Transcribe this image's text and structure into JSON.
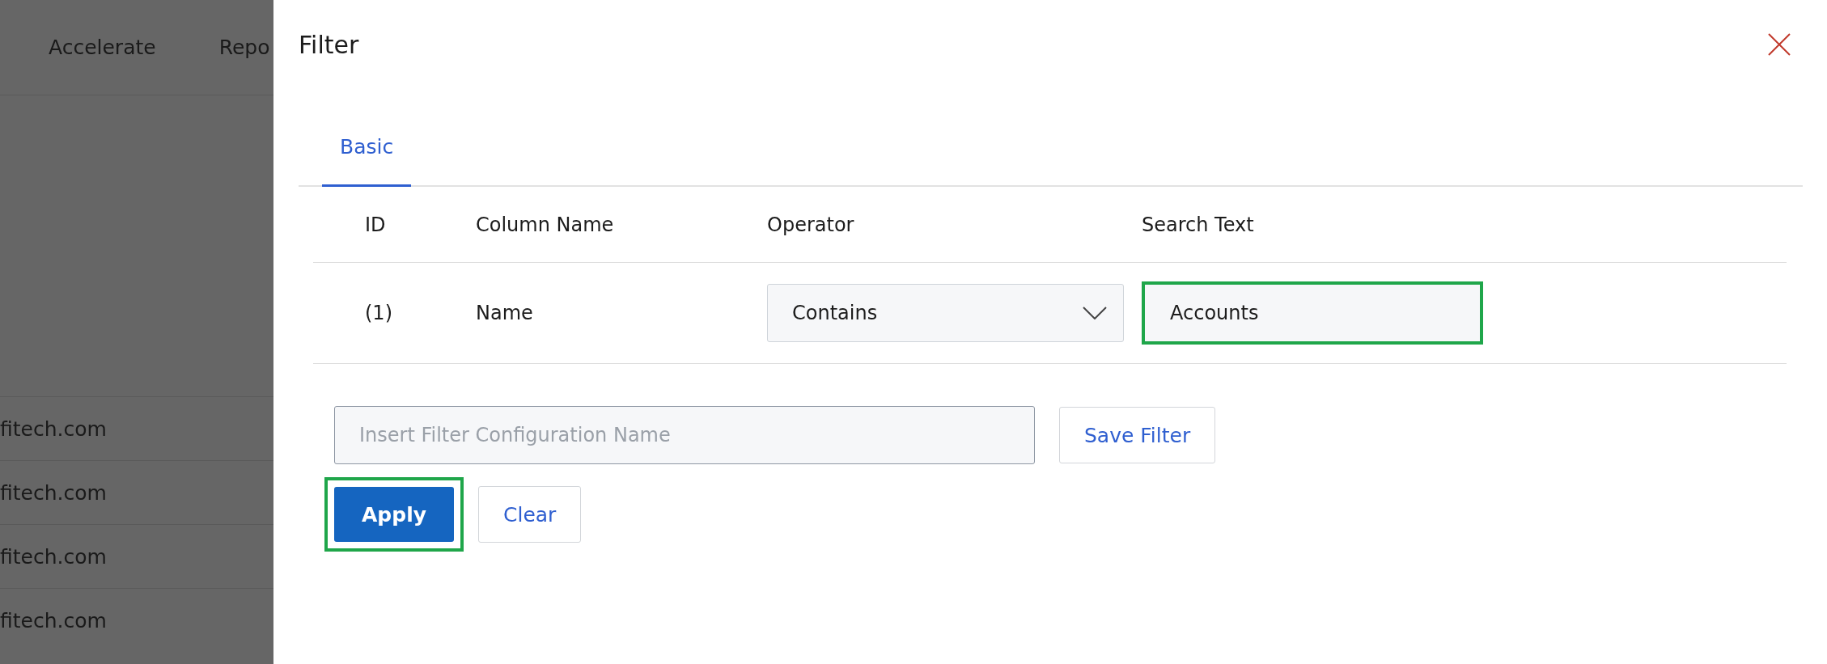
{
  "background_page": {
    "nav_items": [
      "Accelerate",
      "Repo"
    ],
    "rows": [
      "fitech.com",
      "fitech.com",
      "fitech.com",
      "fitech.com"
    ]
  },
  "filter_panel": {
    "title": "Filter",
    "tabs": [
      {
        "label": "Basic",
        "selected": true
      }
    ],
    "table": {
      "columns": [
        "ID",
        "Column Name",
        "Operator",
        "Search Text"
      ],
      "rows": [
        {
          "id": "(1)",
          "column_name": "Name",
          "operator": "Contains",
          "search_text": "Accounts",
          "search_highlighted": true
        }
      ]
    },
    "config_name": {
      "placeholder": "Insert Filter Configuration Name"
    },
    "save_button": "Save Filter",
    "apply_button": {
      "label": "Apply",
      "highlighted": true
    },
    "clear_button": "Clear"
  }
}
